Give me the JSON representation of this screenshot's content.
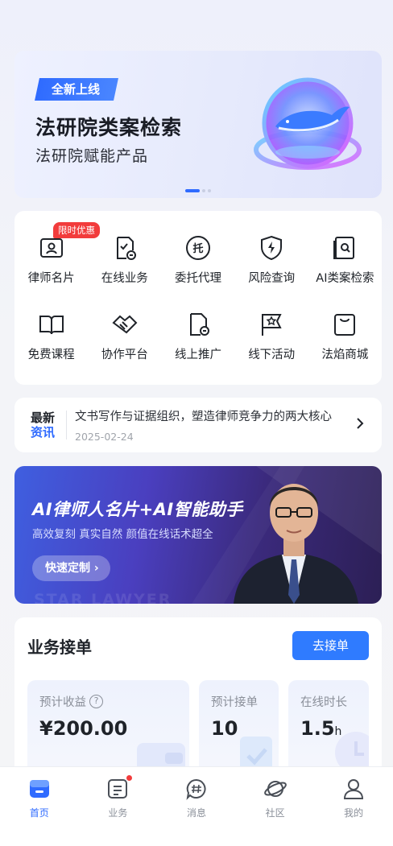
{
  "banner": {
    "tag": "全新上线",
    "title": "法研院类案检索",
    "subtitle": "法研院赋能产品",
    "slide_count": 3,
    "active_slide": 1
  },
  "services": {
    "promo_badge": "限时优惠",
    "items": [
      {
        "label": "律师名片",
        "icon": "id-card-icon"
      },
      {
        "label": "在线业务",
        "icon": "document-check-icon"
      },
      {
        "label": "委托代理",
        "icon": "entrust-icon"
      },
      {
        "label": "风险查询",
        "icon": "shield-bolt-icon"
      },
      {
        "label": "AI类案检索",
        "icon": "search-doc-icon"
      },
      {
        "label": "免费课程",
        "icon": "book-icon"
      },
      {
        "label": "协作平台",
        "icon": "handshake-icon"
      },
      {
        "label": "线上推广",
        "icon": "promotion-icon"
      },
      {
        "label": "线下活动",
        "icon": "flag-star-icon"
      },
      {
        "label": "法焰商城",
        "icon": "shop-bag-icon"
      }
    ]
  },
  "news": {
    "badge_line1": "最新",
    "badge_line2": "资讯",
    "headline": "文书写作与证据组织，塑造律师竞争力的两大核心",
    "date": "2025-02-24"
  },
  "ad": {
    "headline": "AI律师人名片+AI智能助手",
    "subtitle": "高效复刻 真实自然 颜值在线话术超全",
    "button": "快速定制",
    "watermark": "STAR LAWYER"
  },
  "business": {
    "title": "业务接单",
    "take_button": "去接单",
    "stats": [
      {
        "label": "预计收益",
        "value": "¥200.00",
        "has_help": true
      },
      {
        "label": "预计接单",
        "value": "10"
      },
      {
        "label": "在线时长",
        "value": "1.5",
        "unit": "h"
      }
    ]
  },
  "tabbar": {
    "items": [
      {
        "label": "首页",
        "icon": "home-icon",
        "active": true
      },
      {
        "label": "业务",
        "icon": "business-icon",
        "badge": true
      },
      {
        "label": "消息",
        "icon": "message-icon"
      },
      {
        "label": "社区",
        "icon": "community-icon"
      },
      {
        "label": "我的",
        "icon": "profile-icon"
      }
    ]
  },
  "colors": {
    "accent": "#2f6bff",
    "button": "#2f7bff",
    "badge_red": "#f23c3c"
  }
}
